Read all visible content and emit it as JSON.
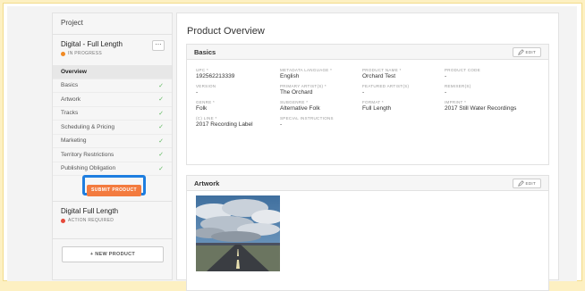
{
  "sidebar": {
    "project_label": "Project",
    "product1": {
      "title": "Digital - Full Length",
      "status": "IN PROGRESS",
      "status_color": "#f08a24",
      "more": "⋯"
    },
    "items": [
      {
        "label": "Overview",
        "check": ""
      },
      {
        "label": "Basics",
        "check": "✓"
      },
      {
        "label": "Artwork",
        "check": "✓"
      },
      {
        "label": "Tracks",
        "check": "✓"
      },
      {
        "label": "Scheduling & Pricing",
        "check": "✓"
      },
      {
        "label": "Marketing",
        "check": "✓"
      },
      {
        "label": "Territory Restrictions",
        "check": "✓"
      },
      {
        "label": "Publishing Obligation",
        "check": "✓"
      }
    ],
    "submit_label": "SUBMIT PRODUCT",
    "product2": {
      "title": "Digital Full Length",
      "status": "ACTION REQUIRED",
      "status_color": "#e64a3b"
    },
    "new_product_label": "+ NEW PRODUCT"
  },
  "main": {
    "page_title": "Product Overview",
    "basics": {
      "title": "Basics",
      "edit_label": "EDIT",
      "fields": [
        {
          "label": "UPC *",
          "value": "192562213339"
        },
        {
          "label": "METADATA LANGUAGE *",
          "value": "English"
        },
        {
          "label": "PRODUCT NAME *",
          "value": "Orchard Test"
        },
        {
          "label": "PRODUCT CODE",
          "value": "-"
        },
        {
          "label": "VERSION",
          "value": "-"
        },
        {
          "label": "PRIMARY ARTIST(S) *",
          "value": "The Orchard"
        },
        {
          "label": "FEATURED ARTIST(S)",
          "value": "-"
        },
        {
          "label": "REMIXER(S)",
          "value": "-"
        },
        {
          "label": "GENRE *",
          "value": "Folk"
        },
        {
          "label": "SUBGENRE *",
          "value": "Alternative Folk"
        },
        {
          "label": "FORMAT *",
          "value": "Full Length"
        },
        {
          "label": "IMPRINT *",
          "value": "2017 Still Water Recordings"
        },
        {
          "label": "(C) LINE *",
          "value": "2017 Recording Label"
        },
        {
          "label": "SPECIAL INSTRUCTIONS",
          "value": "-"
        }
      ]
    },
    "artwork": {
      "title": "Artwork",
      "edit_label": "EDIT"
    }
  },
  "colors": {
    "accent_orange": "#f37b3f",
    "highlight_blue": "#1e7ee0",
    "check_green": "#5cb85c",
    "outer_background": "#fdf0c2"
  }
}
